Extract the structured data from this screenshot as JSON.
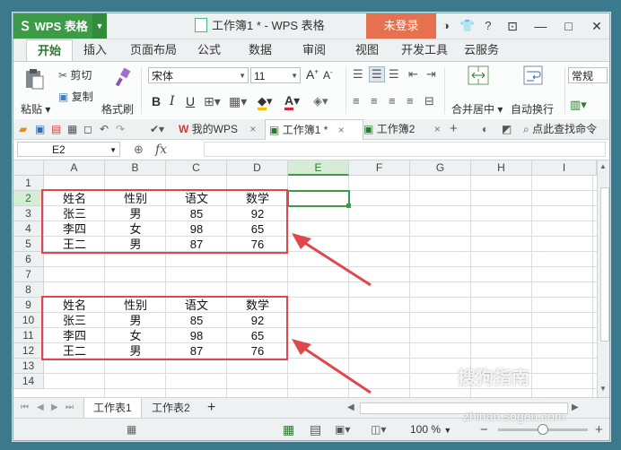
{
  "app": {
    "name": "WPS 表格",
    "doc_title": "工作簿1 * - WPS 表格",
    "login_label": "未登录",
    "help_label": "?",
    "minimize": "—",
    "maximize": "□",
    "close": "✕"
  },
  "menu": {
    "tabs": [
      "开始",
      "插入",
      "页面布局",
      "公式",
      "数据",
      "审阅",
      "视图",
      "开发工具",
      "云服务"
    ]
  },
  "ribbon": {
    "paste": "粘贴",
    "cut": "剪切",
    "copy": "复制",
    "format_painter": "格式刷",
    "font_name": "宋体",
    "font_size": "11",
    "bold": "B",
    "italic": "I",
    "underline": "U",
    "font_grow": "A",
    "font_shrink": "A",
    "font_color_label": "A",
    "merge_center": "合并居中",
    "wrap_text": "自动换行",
    "number_format": "常规"
  },
  "docbar": {
    "my_wps": "我的WPS",
    "tabs": [
      "工作簿1 *",
      "工作簿2"
    ],
    "search_placeholder": "点此查找命令"
  },
  "formula_bar": {
    "cell_ref": "E2",
    "fx": "fx",
    "value": ""
  },
  "grid": {
    "columns": [
      "A",
      "B",
      "C",
      "D",
      "E",
      "F",
      "G",
      "H",
      "I"
    ],
    "rows": [
      "1",
      "2",
      "3",
      "4",
      "5",
      "6",
      "7",
      "8",
      "9",
      "10",
      "11",
      "12",
      "13",
      "14"
    ],
    "selected_column": "E",
    "selected_row": "2",
    "table1": {
      "headers": [
        "姓名",
        "性别",
        "语文",
        "数学"
      ],
      "rows": [
        [
          "张三",
          "男",
          "85",
          "92"
        ],
        [
          "李四",
          "女",
          "98",
          "65"
        ],
        [
          "王二",
          "男",
          "87",
          "76"
        ]
      ]
    },
    "table2": {
      "headers": [
        "姓名",
        "性别",
        "语文",
        "数学"
      ],
      "rows": [
        [
          "张三",
          "男",
          "85",
          "92"
        ],
        [
          "李四",
          "女",
          "98",
          "65"
        ],
        [
          "王二",
          "男",
          "87",
          "76"
        ]
      ]
    },
    "highlight_color": "#e0474c",
    "accent_color": "#3b9b46"
  },
  "sheets": {
    "tabs": [
      "工作表1",
      "工作表2"
    ],
    "add": "+"
  },
  "status": {
    "zoom": "100 %",
    "zoom_level": 0.5
  },
  "watermark": {
    "brand": "搜狗指南",
    "url": "zhinan.sogou.com"
  }
}
